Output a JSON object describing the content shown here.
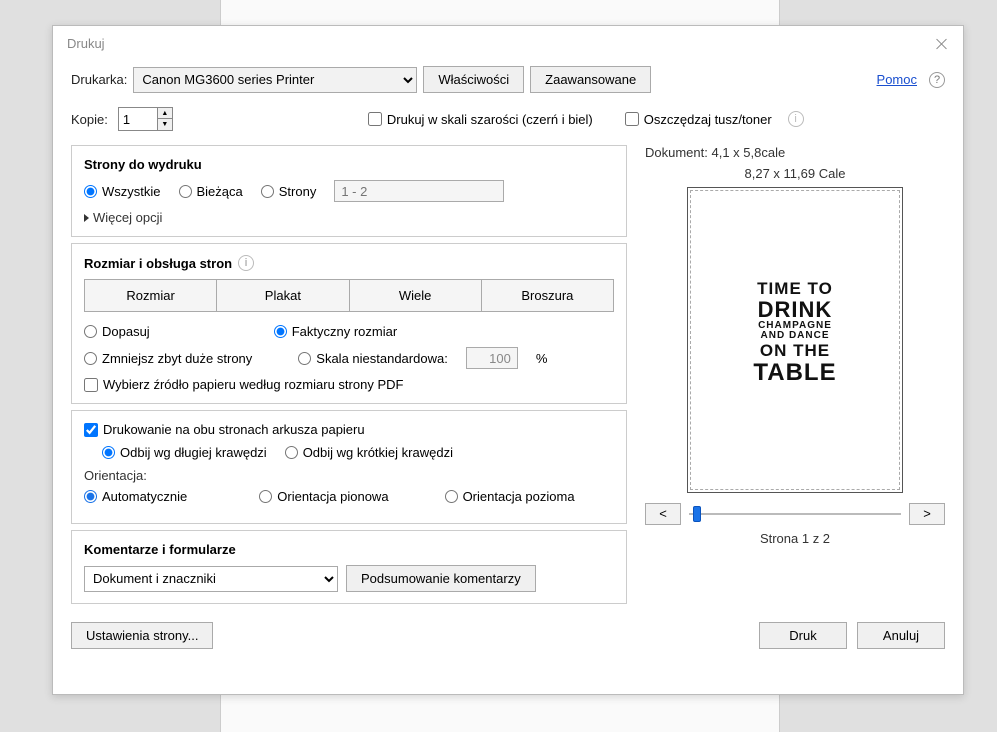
{
  "title": "Drukuj",
  "help": "Pomoc",
  "printer_label": "Drukarka:",
  "printer_val": "Canon MG3600 series Printer",
  "btn_properties": "Właściwości",
  "btn_advanced": "Zaawansowane",
  "copies_label": "Kopie:",
  "copies_val": "1",
  "greyscale": "Drukuj w skali szarości (czerń i biel)",
  "saveink": "Oszczędzaj tusz/toner",
  "pages_group": "Strony do wydruku",
  "all": "Wszystkie",
  "current": "Bieżąca",
  "pages": "Strony",
  "range_ph": "1 - 2",
  "more": "Więcej opcji",
  "sizing_group": "Rozmiar i obsługa stron",
  "size": "Rozmiar",
  "poster": "Plakat",
  "multi": "Wiele",
  "booklet": "Broszura",
  "fit": "Dopasuj",
  "actual": "Faktyczny rozmiar",
  "shrink": "Zmniejsz zbyt duże strony",
  "custom_scale": "Skala niestandardowa:",
  "custom_scale_val": "100",
  "papersource": "Wybierz źródło papieru według rozmiaru strony PDF",
  "both_sides": "Drukowanie na obu stronach arkusza papieru",
  "flip_long": "Odbij wg długiej krawędzi",
  "flip_short": "Odbij wg krótkiej krawędzi",
  "orientation": "Orientacja:",
  "auto": "Automatycznie",
  "portrait": "Orientacja pionowa",
  "landscape": "Orientacja pozioma",
  "comments_group": "Komentarze i formularze",
  "comments_val": "Dokument i znaczniki",
  "btn_summary": "Podsumowanie komentarzy",
  "btn_pagesetup": "Ustawienia strony...",
  "btn_print": "Druk",
  "btn_cancel": "Anuluj",
  "doc_dims": "Dokument: 4,1 x 5,8cale",
  "paper_dims": "8,27 x 11,69 Cale",
  "nav_prev": "<",
  "nav_next": ">",
  "page_label": "Strona 1 z 2",
  "poster_lines": {
    "l1": "TIME TO",
    "l2": "DRINK",
    "l3": "CHAMPAGNE",
    "l4": "AND DANCE",
    "l5": "ON THE",
    "l6": "TABLE"
  }
}
